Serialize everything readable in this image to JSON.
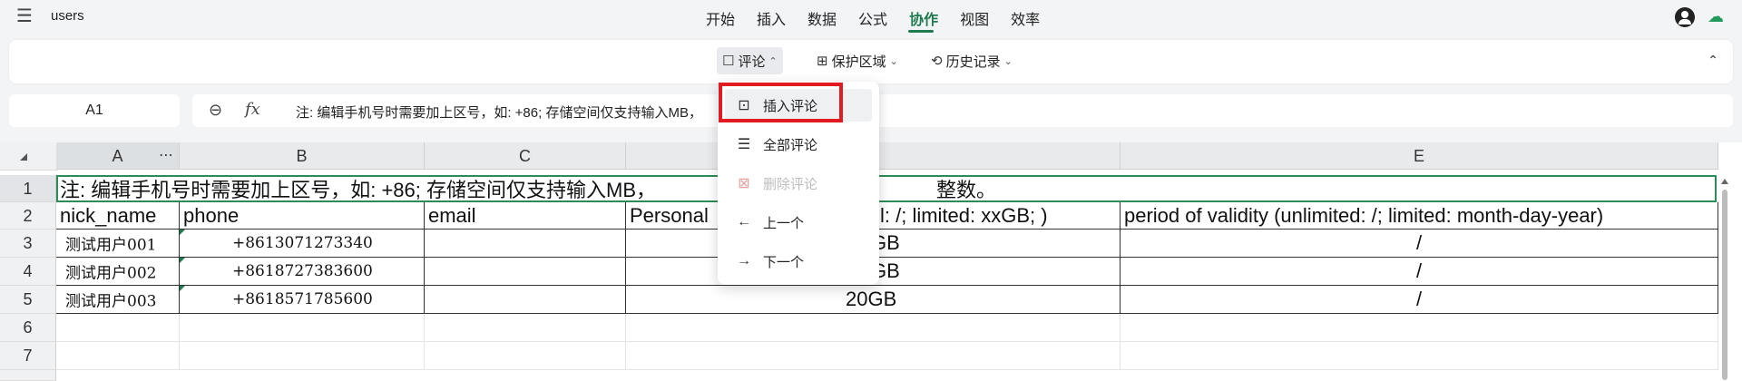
{
  "app": {
    "title": "users"
  },
  "menu": {
    "items": [
      "开始",
      "插入",
      "数据",
      "公式",
      "协作",
      "视图",
      "效率"
    ],
    "active_index": 4
  },
  "ribbon": {
    "comment": "评论",
    "protect": "保护区域",
    "history": "历史记录"
  },
  "namebox": {
    "value": "A1"
  },
  "formula": {
    "fx": "fx",
    "value": "注: 编辑手机号时需要加上区号，如: +86; 存储空间仅支持输入MB，"
  },
  "sheet": {
    "columns": [
      "A",
      "B",
      "C",
      "D",
      "E"
    ],
    "rows": [
      "1",
      "2",
      "3",
      "4",
      "5",
      "6",
      "7"
    ],
    "row1_note": "注: 编辑手机号时需要加上区号，如: +86; 存储空间仅支持输入MB，",
    "row1_tail": "整数。",
    "headers": {
      "a": "nick_name",
      "b": "phone",
      "c": "email",
      "d_left": "Personal",
      "d_right": "l: /; limited: xxGB; )",
      "e": "period of validity (unlimited: /; limited: month-day-year)"
    },
    "data": [
      {
        "nick": "测试用户001",
        "phone": "+8613071273340",
        "email": "",
        "storage": "GB",
        "validity": "/"
      },
      {
        "nick": "测试用户002",
        "phone": "+8618727383600",
        "email": "",
        "storage": "GB",
        "validity": "/"
      },
      {
        "nick": "测试用户003",
        "phone": "+8618571785600",
        "email": "",
        "storage": "20GB",
        "validity": "/"
      }
    ]
  },
  "dropdown": {
    "items": [
      {
        "label": "插入评论",
        "icon": "insert-comment-icon",
        "disabled": false
      },
      {
        "label": "全部评论",
        "icon": "all-comments-icon",
        "disabled": false
      },
      {
        "label": "删除评论",
        "icon": "delete-comment-icon",
        "disabled": true
      },
      {
        "label": "上一个",
        "icon": "arrow-left-icon",
        "disabled": false
      },
      {
        "label": "下一个",
        "icon": "arrow-right-icon",
        "disabled": false
      }
    ]
  },
  "colors": {
    "accent": "#1f7a4f",
    "highlight_box": "#e11b22"
  }
}
